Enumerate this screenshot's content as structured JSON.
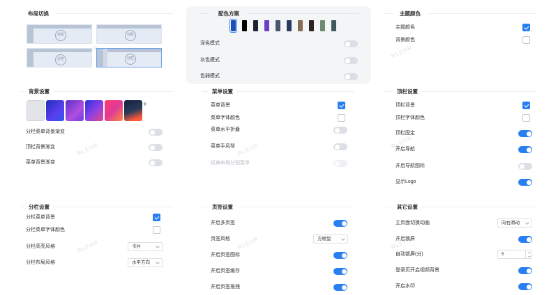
{
  "layout_switch": {
    "title": "布局切换",
    "stamp_text": "分栏",
    "selected_index": 3
  },
  "color_scheme": {
    "title": "配色方案",
    "swatches": [
      "#1a4fb8",
      "#000000",
      "#1f2230",
      "#6b3fc9",
      "#4a5570",
      "#2a3b5f",
      "#8a6a55",
      "#2e2420",
      "#6e8a72",
      "#3f5a5e"
    ],
    "dark_mode": "深色模式",
    "gray_mode": "灰色模式",
    "weak_mode": "色弱模式"
  },
  "theme_color": {
    "title": "主题颜色",
    "theme_color_label": "主题颜色",
    "bg_color_label": "背景颜色"
  },
  "background": {
    "title": "背景设置",
    "thumbs": [
      "#e2e4e8",
      "#2b3fd6",
      "#7a3fd0",
      "#5a2fd8",
      "#e0307a",
      "#1f2a44"
    ],
    "split_gradient": "分栏菜单背景渐变",
    "header_gradient": "顶栏背景渐变",
    "menu_gradient": "菜单背景渐变"
  },
  "menu": {
    "title": "菜单设置",
    "menu_bg": "菜单背景",
    "menu_font_color": "菜单字体颜色",
    "horizontal_fold": "菜单水平折叠",
    "accordion": "菜单手风琴",
    "classic_split": "经典布局分割菜单"
  },
  "header": {
    "title": "顶栏设置",
    "header_bg": "顶栏背景",
    "header_font_color": "顶栏字体颜色",
    "header_fixed": "顶栏固定",
    "enable_nav": "开启导航",
    "nav_icon": "开启导航图标",
    "show_logo": "显示Logo"
  },
  "split": {
    "title": "分栏设置",
    "split_menu_bg": "分栏菜单背景",
    "split_menu_font": "分栏菜单字体颜色",
    "highlight_style": "分栏高亮风格",
    "highlight_value": "卡片",
    "layout_style": "分栏布局风格",
    "layout_value": "水平方向"
  },
  "tabs": {
    "title": "页签设置",
    "enable_tabs": "开启多页签",
    "tab_style": "页签风格",
    "tab_style_value": "方框型",
    "tab_icon": "开启页签图标",
    "tab_cache": "开启页签缓存",
    "tab_drag": "开启页签拖拽"
  },
  "other": {
    "title": "其它设置",
    "page_anim": "主页面切换动画",
    "page_anim_value": "向右滑动",
    "lock_screen": "开启锁屏",
    "auto_lock": "自动锁屏(分)",
    "auto_lock_value": "5",
    "login_video": "登录页开启视频背景",
    "watermark": "开启水印"
  },
  "watermark_text": "RLEHR"
}
